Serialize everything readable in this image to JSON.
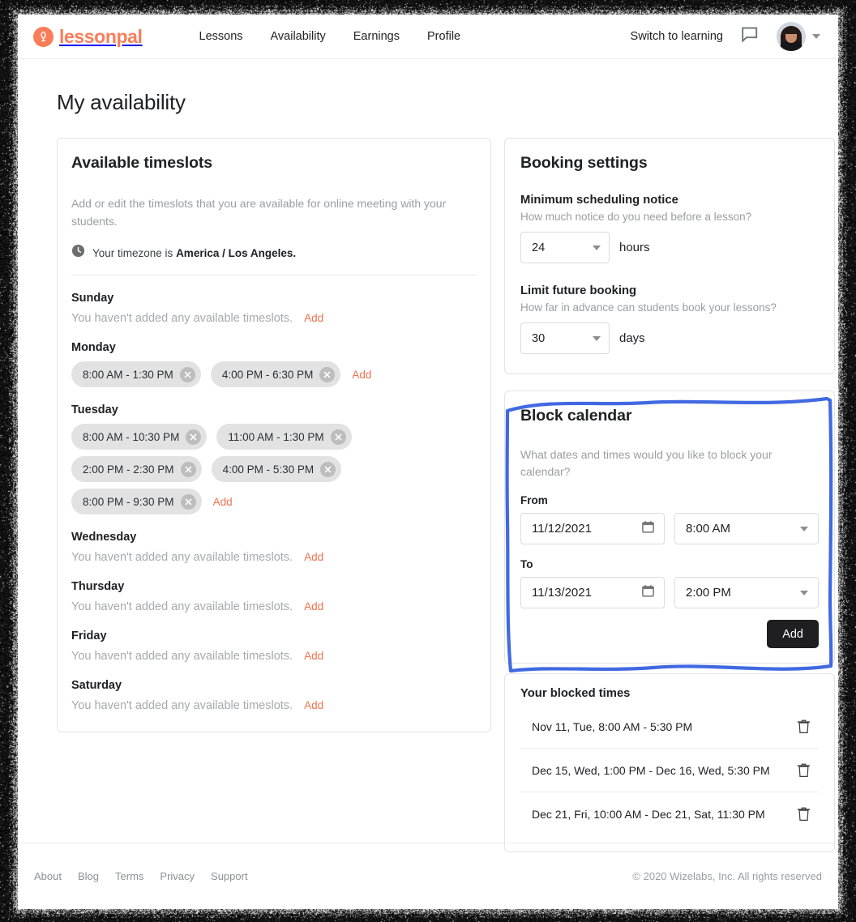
{
  "brand": {
    "name": "lessonpal",
    "logo_icon": "lessonpal-mark-icon",
    "color": "#fa7d5a"
  },
  "header": {
    "nav": [
      {
        "label": "Lessons"
      },
      {
        "label": "Availability"
      },
      {
        "label": "Earnings"
      },
      {
        "label": "Profile"
      }
    ],
    "switch_label": "Switch to learning",
    "chat_icon": "chat-bubble-icon",
    "avatar_icon": "user-avatar",
    "account_caret_icon": "chevron-down-icon"
  },
  "page_title": "My availability",
  "timeslots": {
    "title": "Available timeslots",
    "description": "Add or edit the timeslots that you are available for online meeting with your students.",
    "timezone_icon": "clock-icon",
    "timezone_prefix": "Your timezone is ",
    "timezone_value": "America / Los Angeles.",
    "empty_text": "You haven't added any available timeslots.",
    "add_label": "Add",
    "days": [
      {
        "name": "Sunday",
        "slots": []
      },
      {
        "name": "Monday",
        "slots": [
          "8:00 AM - 1:30 PM",
          "4:00 PM - 6:30 PM"
        ]
      },
      {
        "name": "Tuesday",
        "slots": [
          "8:00 AM - 10:30 PM",
          "11:00 AM - 1:30 PM",
          "2:00 PM - 2:30 PM",
          "4:00 PM - 5:30 PM",
          "8:00 PM - 9:30 PM"
        ]
      },
      {
        "name": "Wednesday",
        "slots": []
      },
      {
        "name": "Thursday",
        "slots": []
      },
      {
        "name": "Friday",
        "slots": []
      },
      {
        "name": "Saturday",
        "slots": []
      }
    ]
  },
  "booking_settings": {
    "title": "Booking settings",
    "min_notice": {
      "label": "Minimum scheduling notice",
      "help": "How much notice do you need before a lesson?",
      "value": "24",
      "unit": "hours"
    },
    "limit_future": {
      "label": "Limit future booking",
      "help": "How far in advance can students book your lessons?",
      "value": "30",
      "unit": "days"
    }
  },
  "block_calendar": {
    "title": "Block calendar",
    "description": "What dates and times would you like to block your calendar?",
    "from_label": "From",
    "to_label": "To",
    "from_date": "11/12/2021",
    "from_time": "8:00 AM",
    "to_date": "11/13/2021",
    "to_time": "2:00 PM",
    "calendar_icon": "calendar-icon",
    "time_caret_icon": "chevron-down-icon",
    "add_label": "Add",
    "highlight_color": "#4169e1"
  },
  "blocked_times": {
    "title": "Your blocked times",
    "delete_icon": "trash-icon",
    "items": [
      {
        "text": "Nov 11, Tue, 8:00 AM - 5:30 PM"
      },
      {
        "text": "Dec 15, Wed, 1:00 PM - Dec 16, Wed, 5:30 PM"
      },
      {
        "text": "Dec 21, Fri, 10:00 AM - Dec 21, Sat, 11:30 PM"
      }
    ]
  },
  "footer": {
    "links": [
      {
        "label": "About"
      },
      {
        "label": "Blog"
      },
      {
        "label": "Terms"
      },
      {
        "label": "Privacy"
      },
      {
        "label": "Support"
      }
    ],
    "copyright": "© 2020 Wizelabs, Inc. All rights reserved"
  }
}
